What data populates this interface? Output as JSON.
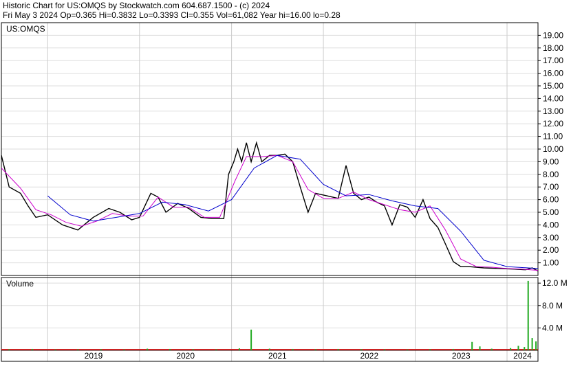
{
  "header": {
    "line1": "Historic Chart for US:OMQS by Stockwatch.com 604.687.1500 - (c) 2024",
    "line2": "Fri May  3 2024   Op=0.365   Hi=0.3832   Lo=0.3393   Cl=0.355   Vol=61,082   Year hi=16.00   lo=0.28"
  },
  "chart_data": {
    "type": "line",
    "symbol_label": "US:OMQS",
    "volume_label": "Volume",
    "price_axis": {
      "range": [
        0,
        20
      ],
      "ticks": [
        "1.00",
        "2.00",
        "3.00",
        "4.00",
        "5.00",
        "6.00",
        "7.00",
        "8.00",
        "9.00",
        "10.00",
        "11.00",
        "12.00",
        "13.00",
        "14.00",
        "15.00",
        "16.00",
        "17.00",
        "18.00",
        "19.00"
      ]
    },
    "volume_axis": {
      "range": [
        0,
        13000000
      ],
      "ticks": [
        "4.0 M",
        "8.0 M",
        "12.0 M"
      ]
    },
    "x_axis": {
      "range": [
        "2018-07-01",
        "2024-05-03"
      ],
      "year_ticks": [
        "2019",
        "2020",
        "2021",
        "2022",
        "2023",
        "2024"
      ]
    },
    "series": [
      {
        "color": "#000000",
        "x": [
          "2018-07-01",
          "2018-08-01",
          "2018-09-15",
          "2018-10-15",
          "2018-11-15",
          "2019-01-01",
          "2019-03-01",
          "2019-05-01",
          "2019-07-01",
          "2019-09-01",
          "2019-10-15",
          "2019-12-01",
          "2020-01-01",
          "2020-02-15",
          "2020-03-15",
          "2020-04-15",
          "2020-06-01",
          "2020-07-15",
          "2020-09-01",
          "2020-10-15",
          "2020-12-01",
          "2020-12-20",
          "2021-01-10",
          "2021-01-25",
          "2021-02-10",
          "2021-03-01",
          "2021-03-20",
          "2021-04-10",
          "2021-05-01",
          "2021-06-01",
          "2021-07-01",
          "2021-08-01",
          "2021-09-01",
          "2021-10-01",
          "2021-11-01",
          "2021-12-01",
          "2022-01-15",
          "2022-03-01",
          "2022-04-01",
          "2022-05-01",
          "2022-06-01",
          "2022-07-01",
          "2022-08-01",
          "2022-09-01",
          "2022-10-01",
          "2022-11-01",
          "2022-12-01",
          "2023-01-01",
          "2023-02-01",
          "2023-03-01",
          "2023-04-01",
          "2023-05-01",
          "2023-06-01",
          "2023-07-01",
          "2023-08-01",
          "2023-10-01",
          "2023-12-01",
          "2024-02-01",
          "2024-03-15",
          "2024-04-10",
          "2024-05-03"
        ],
        "y": [
          9.5,
          7.0,
          6.5,
          5.5,
          4.6,
          4.8,
          4.0,
          3.6,
          4.6,
          5.3,
          5.0,
          4.4,
          4.6,
          6.5,
          6.2,
          5.0,
          5.7,
          5.3,
          4.6,
          4.5,
          4.5,
          8.0,
          9.0,
          10.0,
          9.0,
          10.5,
          9.0,
          10.5,
          9.0,
          9.5,
          9.5,
          9.6,
          9.0,
          7.0,
          5.0,
          6.5,
          6.3,
          6.1,
          8.7,
          6.5,
          6.0,
          6.2,
          5.8,
          5.5,
          4.0,
          5.6,
          5.4,
          4.6,
          6.0,
          4.5,
          3.8,
          2.5,
          1.1,
          0.7,
          0.7,
          0.6,
          0.55,
          0.5,
          0.45,
          0.6,
          0.36
        ]
      },
      {
        "color": "#cc00cc",
        "x": [
          "2018-07-01",
          "2018-09-15",
          "2018-11-15",
          "2019-01-15",
          "2019-03-15",
          "2019-05-15",
          "2019-07-15",
          "2019-09-15",
          "2019-11-15",
          "2020-01-15",
          "2020-03-15",
          "2020-05-15",
          "2020-07-15",
          "2020-09-15",
          "2020-11-15",
          "2021-01-15",
          "2021-03-01",
          "2021-05-01",
          "2021-07-01",
          "2021-09-01",
          "2021-11-01",
          "2022-01-01",
          "2022-03-01",
          "2022-05-01",
          "2022-07-01",
          "2022-09-01",
          "2022-11-01",
          "2023-01-01",
          "2023-03-01",
          "2023-05-01",
          "2023-07-01",
          "2023-09-01",
          "2023-11-01",
          "2024-01-01",
          "2024-03-01",
          "2024-05-03"
        ],
        "y": [
          8.5,
          6.9,
          5.2,
          4.8,
          4.2,
          3.9,
          4.3,
          4.9,
          4.7,
          4.7,
          6.2,
          5.4,
          5.4,
          4.6,
          4.6,
          7.5,
          9.4,
          9.4,
          9.5,
          9.0,
          6.8,
          6.1,
          6.1,
          6.6,
          6.0,
          5.6,
          5.2,
          5.0,
          5.5,
          3.6,
          1.3,
          0.7,
          0.65,
          0.55,
          0.5,
          0.4
        ]
      },
      {
        "color": "#0000cc",
        "x": [
          "2019-01-01",
          "2019-04-01",
          "2019-07-01",
          "2019-10-01",
          "2020-01-01",
          "2020-04-01",
          "2020-07-01",
          "2020-10-01",
          "2021-01-01",
          "2021-04-01",
          "2021-07-01",
          "2021-10-01",
          "2022-01-01",
          "2022-04-01",
          "2022-07-01",
          "2022-10-01",
          "2023-01-01",
          "2023-04-01",
          "2023-07-01",
          "2023-10-01",
          "2024-01-01",
          "2024-05-03"
        ],
        "y": [
          6.3,
          4.8,
          4.3,
          4.6,
          4.9,
          5.8,
          5.6,
          5.1,
          6.0,
          8.5,
          9.5,
          9.2,
          7.2,
          6.3,
          6.4,
          5.9,
          5.5,
          5.3,
          3.5,
          1.2,
          0.7,
          0.55
        ]
      }
    ],
    "volume": {
      "x": [
        "2018-08-01",
        "2018-11-01",
        "2019-02-01",
        "2019-05-01",
        "2019-08-01",
        "2019-11-01",
        "2020-02-01",
        "2020-05-01",
        "2020-08-01",
        "2020-11-01",
        "2021-02-01",
        "2021-03-20",
        "2021-06-01",
        "2021-09-01",
        "2021-12-01",
        "2022-03-01",
        "2022-06-01",
        "2022-09-01",
        "2022-12-01",
        "2023-03-01",
        "2023-06-01",
        "2023-08-15",
        "2023-09-15",
        "2023-11-01",
        "2024-01-15",
        "2024-02-15",
        "2024-03-10",
        "2024-03-25",
        "2024-04-10",
        "2024-04-25"
      ],
      "y": [
        200000,
        250000,
        150000,
        180000,
        200000,
        150000,
        300000,
        250000,
        200000,
        180000,
        350000,
        3700000,
        300000,
        250000,
        200000,
        250000,
        200000,
        180000,
        150000,
        200000,
        250000,
        1500000,
        700000,
        300000,
        400000,
        800000,
        600000,
        12400000,
        2200000,
        1600000
      ]
    }
  }
}
